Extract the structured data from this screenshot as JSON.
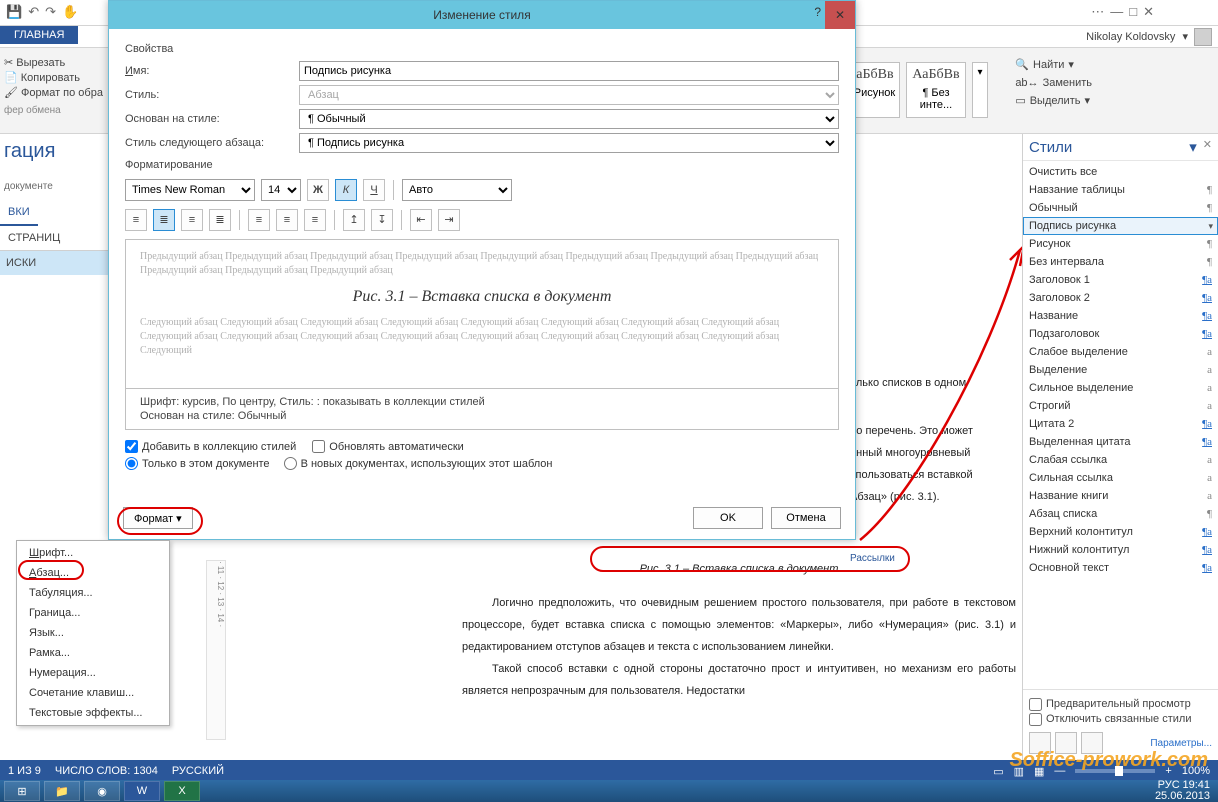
{
  "app": {
    "user": "Nikolay Koldovsky"
  },
  "tabs": {
    "home": "ГЛАВНАЯ"
  },
  "ribbon": {
    "cut": "Вырезать",
    "copy": "Копировать",
    "format_painter": "Формат по обра",
    "clipboard_group": "фер обмена",
    "gallery": [
      {
        "sample": "АаБбВв",
        "name": "¶ Рисунок"
      },
      {
        "sample": "АаБбВв",
        "name": "¶ Без инте..."
      }
    ],
    "find": "Найти",
    "replace": "Заменить",
    "select": "Выделить"
  },
  "nav": {
    "title": "гация",
    "sub": "документе",
    "tab1": "ВКИ",
    "tab2": "СТРАНИЦ",
    "item1": "ИСКИ"
  },
  "dialog": {
    "title": "Изменение стиля",
    "properties": "Свойства",
    "name_label": "Имя:",
    "name_value": "Подпись рисунка",
    "styletype_label": "Стиль:",
    "styletype_value": "Абзац",
    "basedon_label": "Основан на стиле:",
    "basedon_value": "¶  Обычный",
    "nextstyle_label": "Стиль следующего абзаца:",
    "nextstyle_value": "¶  Подпись рисунка",
    "formatting": "Форматирование",
    "font": "Times New Roman",
    "size": "14",
    "color": "Авто",
    "prev_text": "Предыдущий абзац Предыдущий абзац Предыдущий абзац Предыдущий абзац Предыдущий абзац Предыдущий абзац Предыдущий абзац Предыдущий абзац Предыдущий абзац Предыдущий абзац Предыдущий абзац",
    "sample": "Рис. 3.1 – Вставка списка в документ",
    "next_text": "Следующий абзац Следующий абзац Следующий абзац Следующий абзац Следующий абзац Следующий абзац Следующий абзац Следующий абзац Следующий абзац Следующий абзац Следующий абзац Следующий абзац Следующий абзац Следующий абзац Следующий абзац Следующий абзац Следующий",
    "desc1": "Шрифт: курсив, По центру, Стиль: : показывать в коллекции стилей",
    "desc2": "Основан на стиле: Обычный",
    "add_gallery": "Добавить в коллекцию стилей",
    "auto_update": "Обновлять автоматически",
    "only_doc": "Только в этом документе",
    "new_docs": "В новых документах, использующих этот шаблон",
    "format_btn": "Формат",
    "ok": "OK",
    "cancel": "Отмена"
  },
  "menu": {
    "font": "Шрифт...",
    "paragraph": "Абзац...",
    "tabs": "Табуляция...",
    "border": "Граница...",
    "language": "Язык...",
    "frame": "Рамка...",
    "numbering": "Нумерация...",
    "shortcut": "Сочетание клавиш...",
    "texteffects": "Текстовые эффекты..."
  },
  "doc": {
    "right_snip1": "олько списков в одном",
    "right_snip2": "бо перечень. Это может",
    "right_snip3": "анный многоуровневый",
    "right_snip4": "спользоваться вставкой",
    "right_snip5": "Абзац» (рис. 3.1).",
    "right_snip6": "Рассылки",
    "caption": "Рис. 3.1 – Вставка списка в документ",
    "p1": "Логично  предположить,  что  очевидным  решением  простого пользователя, при работе в текстовом процессоре, будет вставка списка с помощью  элементов:  «Маркеры»,  либо  «Нумерация»  (рис.  3.1)  и редактированием отступов абзацев и текста с использованием линейки.",
    "p2": "Такой способ вставки с одной стороны достаточно прост и интуитивен, но механизм его работы является непрозрачным для пользователя. Недостатки"
  },
  "styles": {
    "title": "Стили",
    "items": [
      {
        "name": "Очистить все",
        "sym": ""
      },
      {
        "name": "Навзание таблицы",
        "sym": "¶"
      },
      {
        "name": "Обычный",
        "sym": "¶"
      },
      {
        "name": "Подпись рисунка",
        "sym": "",
        "selected": true
      },
      {
        "name": "Рисунок",
        "sym": "¶"
      },
      {
        "name": "Без интервала",
        "sym": "¶"
      },
      {
        "name": "Заголовок 1",
        "sym": "¶a",
        "link": true
      },
      {
        "name": "Заголовок 2",
        "sym": "¶a",
        "link": true
      },
      {
        "name": "Название",
        "sym": "¶a",
        "link": true
      },
      {
        "name": "Подзаголовок",
        "sym": "¶a",
        "link": true
      },
      {
        "name": "Слабое выделение",
        "sym": "a"
      },
      {
        "name": "Выделение",
        "sym": "a"
      },
      {
        "name": "Сильное выделение",
        "sym": "a"
      },
      {
        "name": "Строгий",
        "sym": "a"
      },
      {
        "name": "Цитата 2",
        "sym": "¶a",
        "link": true
      },
      {
        "name": "Выделенная цитата",
        "sym": "¶a",
        "link": true
      },
      {
        "name": "Слабая ссылка",
        "sym": "a"
      },
      {
        "name": "Сильная ссылка",
        "sym": "a"
      },
      {
        "name": "Название книги",
        "sym": "a"
      },
      {
        "name": "Абзац списка",
        "sym": "¶"
      },
      {
        "name": "Верхний колонтитул",
        "sym": "¶a",
        "link": true
      },
      {
        "name": "Нижний колонтитул",
        "sym": "¶a",
        "link": true
      },
      {
        "name": "Основной текст",
        "sym": "¶a",
        "link": true
      }
    ],
    "preview_chk": "Предварительный просмотр",
    "disable_linked": "Отключить связанные стили",
    "options": "Параметры..."
  },
  "status": {
    "page": "1 ИЗ 9",
    "words": "ЧИСЛО СЛОВ: 1304",
    "lang": "РУССКИЙ",
    "zoom": "100%"
  },
  "taskbar": {
    "lang": "РУС",
    "time": "19:41",
    "date": "25.06.2013"
  },
  "watermark": "Soffice-prowork.com"
}
